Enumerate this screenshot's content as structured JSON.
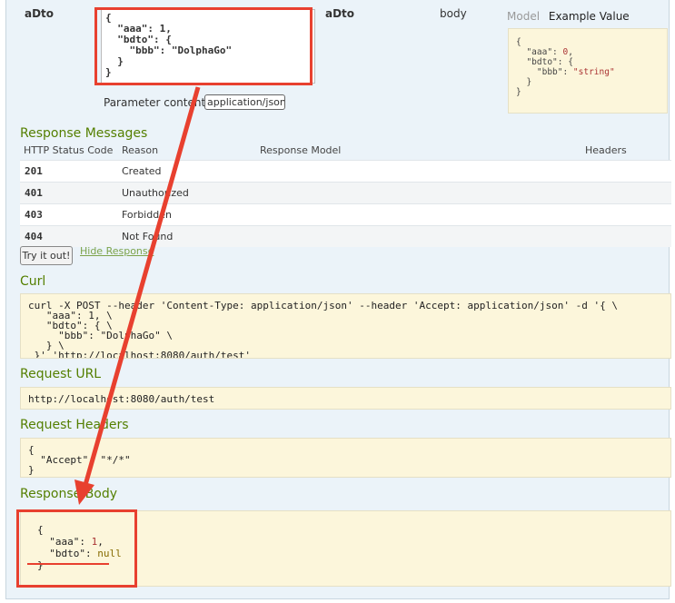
{
  "param": {
    "name": "aDto",
    "value": "{\n  \"aaa\": 1,\n  \"bdto\": {\n    \"bbb\": \"DolphaGo\"\n  }\n}",
    "type": "aDto",
    "param_in": "body",
    "content_type_label": "Parameter content type",
    "content_type_value": "application/json"
  },
  "model_tabs": {
    "model": "Model",
    "example": "Example Value"
  },
  "example_value": {
    "open": "{",
    "aaa_key": "  \"aaa\": ",
    "aaa_val": "0",
    "bdto_line": "  \"bdto\": {",
    "bbb_key": "    \"bbb\": ",
    "bbb_val": "\"string\"",
    "inner_close": "  }",
    "close": "}"
  },
  "response_messages": {
    "title": "Response Messages",
    "columns": [
      "HTTP Status Code",
      "Reason",
      "Response Model",
      "Headers"
    ],
    "rows": [
      {
        "code": "201",
        "reason": "Created"
      },
      {
        "code": "401",
        "reason": "Unauthorized"
      },
      {
        "code": "403",
        "reason": "Forbidden"
      },
      {
        "code": "404",
        "reason": "Not Found"
      }
    ]
  },
  "actions": {
    "try_it": "Try it out!",
    "hide_response": "Hide Response"
  },
  "curl": {
    "title": "Curl",
    "command": "curl -X POST --header 'Content-Type: application/json' --header 'Accept: application/json' -d '{ \\\n   \"aaa\": 1, \\\n   \"bdto\": { \\\n     \"bbb\": \"DolphaGo\" \\\n   } \\\n }' 'http://localhost:8080/auth/test'"
  },
  "request_url": {
    "title": "Request URL",
    "value": "http://localhost:8080/auth/test"
  },
  "request_headers": {
    "title": "Request Headers",
    "value": "{\n  \"Accept\": \"*/*\"\n}"
  },
  "response_body": {
    "title": "Response Body",
    "open": "{",
    "aaa_key": "  \"aaa\": ",
    "aaa_val": "1",
    "bdto_key": "  \"bdto\": ",
    "bdto_val": "null",
    "close": "}"
  },
  "annotation_color": "#e8402f"
}
